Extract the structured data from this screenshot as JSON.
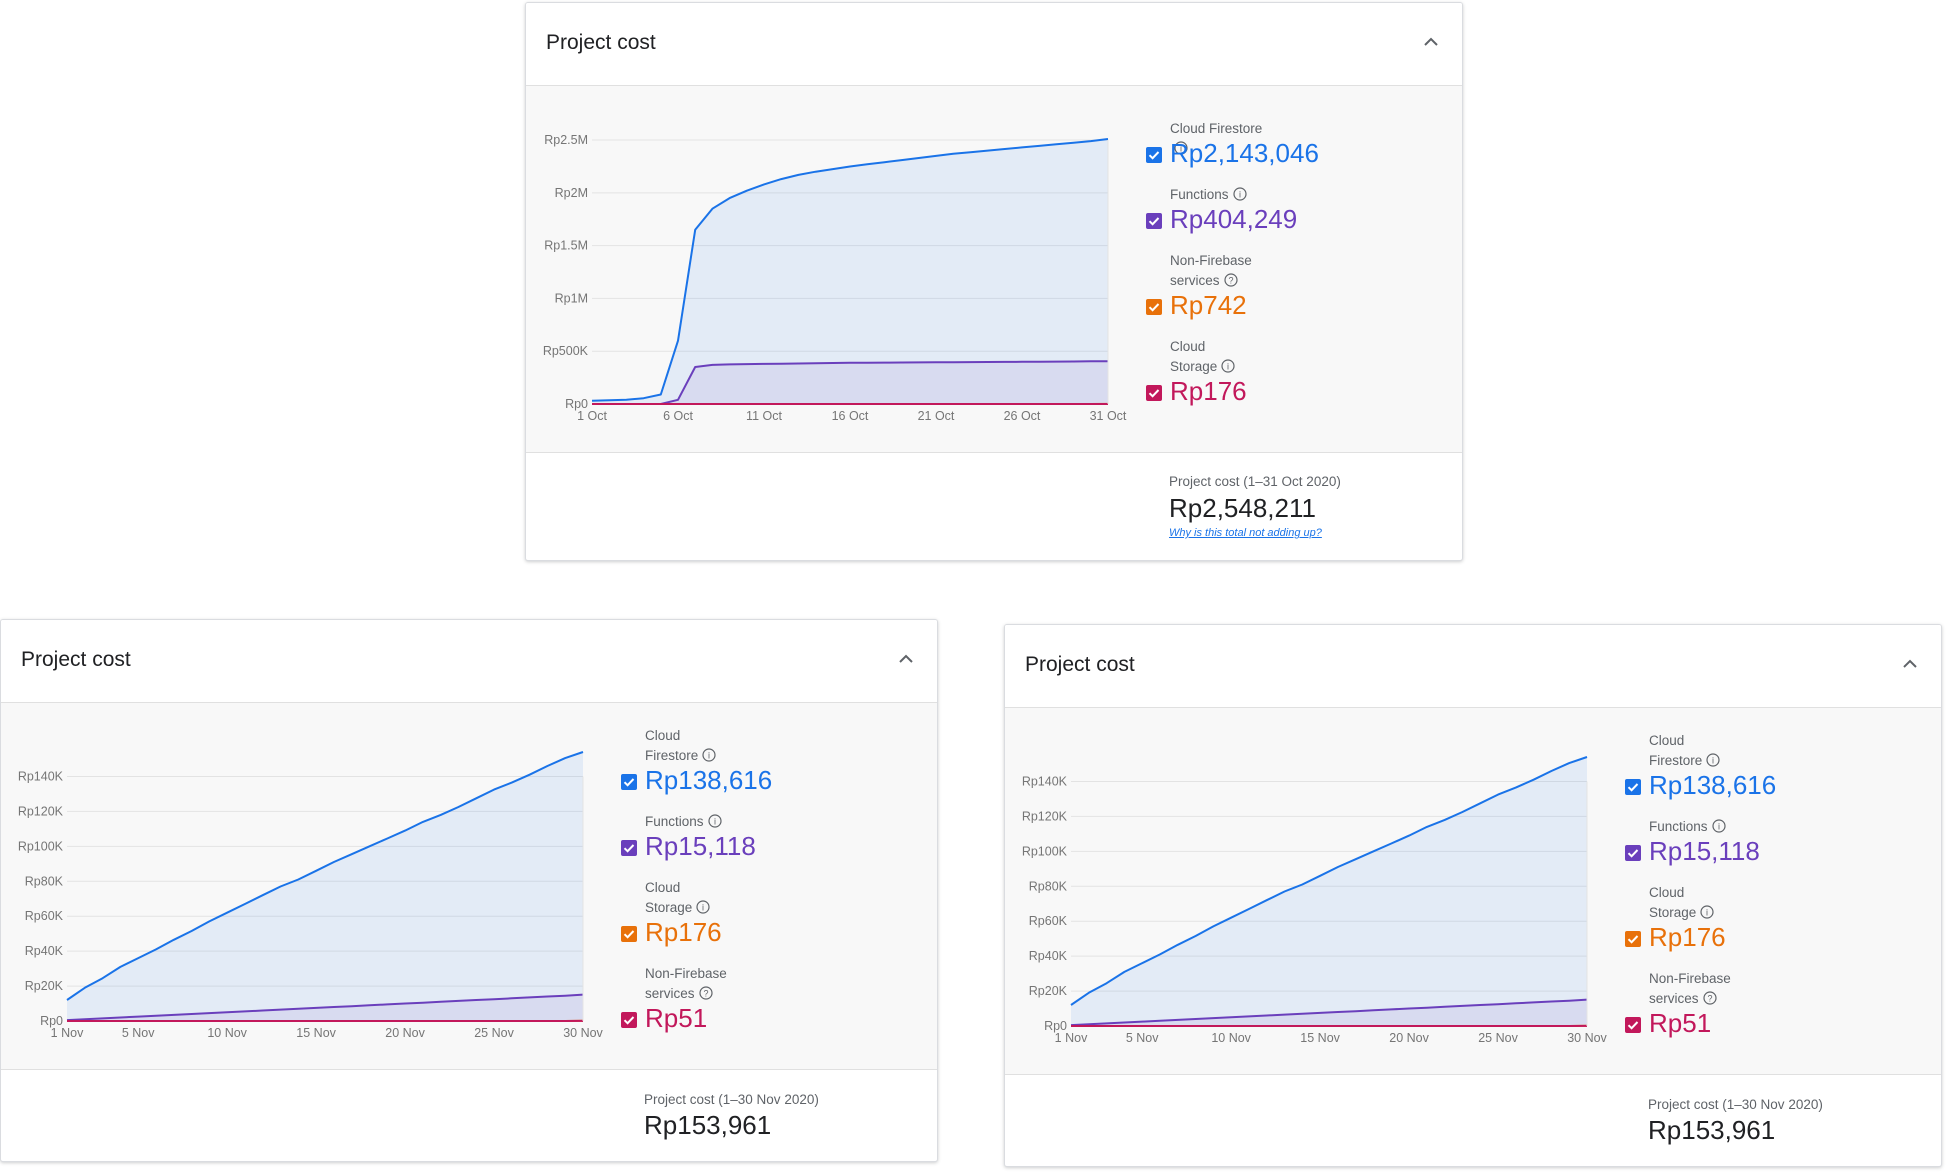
{
  "cards": [
    {
      "title": "Project cost",
      "legend": [
        {
          "name_lines": [
            "Cloud Firestore"
          ],
          "info": "i",
          "value": "Rp2,143,046",
          "color": "#1a73e8"
        },
        {
          "name_lines": [
            "Functions"
          ],
          "info": "i",
          "value": "Rp404,249",
          "color": "#6a3fbc"
        },
        {
          "name_lines": [
            "Non-Firebase",
            "services"
          ],
          "info": "?",
          "value": "Rp742",
          "color": "#e8710a"
        },
        {
          "name_lines": [
            "Cloud",
            "Storage"
          ],
          "info": "i",
          "value": "Rp176",
          "color": "#c2185b"
        }
      ],
      "total": {
        "label": "Project cost (1–31 Oct 2020)",
        "value": "Rp2,548,211",
        "link": "Why is this total not adding up?"
      }
    },
    {
      "title": "Project cost",
      "legend": [
        {
          "name_lines": [
            "Cloud",
            "Firestore"
          ],
          "info": "i",
          "value": "Rp138,616",
          "color": "#1a73e8"
        },
        {
          "name_lines": [
            "Functions"
          ],
          "info": "i",
          "value": "Rp15,118",
          "color": "#6a3fbc"
        },
        {
          "name_lines": [
            "Cloud",
            "Storage"
          ],
          "info": "i",
          "value": "Rp176",
          "color": "#e8710a"
        },
        {
          "name_lines": [
            "Non-Firebase",
            "services"
          ],
          "info": "?",
          "value": "Rp51",
          "color": "#c2185b"
        }
      ],
      "total": {
        "label": "Project cost (1–30 Nov 2020)",
        "value": "Rp153,961",
        "link": ""
      }
    },
    {
      "title": "Project cost",
      "legend": [
        {
          "name_lines": [
            "Cloud",
            "Firestore"
          ],
          "info": "i",
          "value": "Rp138,616",
          "color": "#1a73e8"
        },
        {
          "name_lines": [
            "Functions"
          ],
          "info": "i",
          "value": "Rp15,118",
          "color": "#6a3fbc"
        },
        {
          "name_lines": [
            "Cloud",
            "Storage"
          ],
          "info": "i",
          "value": "Rp176",
          "color": "#e8710a"
        },
        {
          "name_lines": [
            "Non-Firebase",
            "services"
          ],
          "info": "?",
          "value": "Rp51",
          "color": "#c2185b"
        }
      ],
      "total": {
        "label": "Project cost (1–30 Nov 2020)",
        "value": "Rp153,961",
        "link": ""
      }
    }
  ],
  "chart_data": [
    {
      "type": "area",
      "title": "Project cost",
      "x": [
        "1 Oct",
        "2 Oct",
        "3 Oct",
        "4 Oct",
        "5 Oct",
        "6 Oct",
        "7 Oct",
        "8 Oct",
        "9 Oct",
        "10 Oct",
        "11 Oct",
        "12 Oct",
        "13 Oct",
        "14 Oct",
        "15 Oct",
        "16 Oct",
        "17 Oct",
        "18 Oct",
        "19 Oct",
        "20 Oct",
        "21 Oct",
        "22 Oct",
        "23 Oct",
        "24 Oct",
        "25 Oct",
        "26 Oct",
        "27 Oct",
        "28 Oct",
        "29 Oct",
        "30 Oct",
        "31 Oct"
      ],
      "x_ticks": [
        "1 Oct",
        "6 Oct",
        "11 Oct",
        "16 Oct",
        "21 Oct",
        "26 Oct",
        "31 Oct"
      ],
      "y_ticks": [
        "Rp0",
        "Rp500K",
        "Rp1M",
        "Rp1.5M",
        "Rp2M",
        "Rp2.5M"
      ],
      "ylim": [
        0,
        2500000
      ],
      "grid": true,
      "legend_position": "right",
      "series": [
        {
          "name": "Cloud Firestore",
          "color": "#1a73e8",
          "values": [
            30000,
            35000,
            40000,
            55000,
            90000,
            600000,
            1650000,
            1850000,
            1950000,
            2020000,
            2080000,
            2130000,
            2170000,
            2200000,
            2225000,
            2250000,
            2270000,
            2290000,
            2310000,
            2330000,
            2350000,
            2370000,
            2385000,
            2400000,
            2415000,
            2430000,
            2445000,
            2460000,
            2475000,
            2490000,
            2510000
          ]
        },
        {
          "name": "Functions",
          "color": "#6a3fbc",
          "values": [
            0,
            0,
            0,
            0,
            0,
            40000,
            350000,
            370000,
            375000,
            378000,
            380000,
            382000,
            384000,
            386000,
            388000,
            390000,
            391000,
            392000,
            393000,
            394000,
            395000,
            396000,
            397000,
            398000,
            399000,
            400000,
            401000,
            402000,
            403000,
            404000,
            405000
          ]
        },
        {
          "name": "Non-Firebase services",
          "color": "#e8710a",
          "values": [
            0,
            0,
            0,
            0,
            0,
            0,
            0,
            0,
            0,
            0,
            0,
            0,
            0,
            0,
            0,
            0,
            0,
            0,
            0,
            0,
            0,
            0,
            0,
            0,
            0,
            0,
            0,
            0,
            0,
            0,
            742
          ]
        },
        {
          "name": "Cloud Storage",
          "color": "#c2185b",
          "values": [
            0,
            0,
            0,
            0,
            0,
            0,
            0,
            0,
            0,
            0,
            0,
            0,
            0,
            0,
            0,
            0,
            0,
            0,
            0,
            0,
            0,
            0,
            0,
            0,
            0,
            0,
            0,
            0,
            0,
            0,
            176
          ]
        }
      ]
    },
    {
      "type": "area",
      "title": "Project cost",
      "x": [
        "1 Nov",
        "2 Nov",
        "3 Nov",
        "4 Nov",
        "5 Nov",
        "6 Nov",
        "7 Nov",
        "8 Nov",
        "9 Nov",
        "10 Nov",
        "11 Nov",
        "12 Nov",
        "13 Nov",
        "14 Nov",
        "15 Nov",
        "16 Nov",
        "17 Nov",
        "18 Nov",
        "19 Nov",
        "20 Nov",
        "21 Nov",
        "22 Nov",
        "23 Nov",
        "24 Nov",
        "25 Nov",
        "26 Nov",
        "27 Nov",
        "28 Nov",
        "29 Nov",
        "30 Nov"
      ],
      "x_ticks": [
        "1 Nov",
        "5 Nov",
        "10 Nov",
        "15 Nov",
        "20 Nov",
        "25 Nov",
        "30 Nov"
      ],
      "y_ticks": [
        "Rp0",
        "Rp20K",
        "Rp40K",
        "Rp60K",
        "Rp80K",
        "Rp100K",
        "Rp120K",
        "Rp140K"
      ],
      "ylim": [
        0,
        140000
      ],
      "grid": true,
      "legend_position": "right",
      "series": [
        {
          "name": "Cloud Firestore",
          "color": "#1a73e8",
          "values": [
            12000,
            19000,
            24500,
            31000,
            36000,
            41000,
            46500,
            51500,
            57000,
            62000,
            67000,
            72000,
            77000,
            81000,
            86000,
            91000,
            95500,
            100000,
            104500,
            109000,
            114000,
            118000,
            122500,
            127500,
            132500,
            136500,
            141000,
            146000,
            150500,
            154000
          ]
        },
        {
          "name": "Functions",
          "color": "#6a3fbc",
          "values": [
            500,
            1000,
            1500,
            2000,
            2500,
            3000,
            3500,
            4000,
            4500,
            5000,
            5500,
            6000,
            6500,
            7000,
            7500,
            8000,
            8500,
            9000,
            9500,
            10000,
            10500,
            11000,
            11500,
            12000,
            12500,
            13000,
            13500,
            14000,
            14500,
            15118
          ]
        },
        {
          "name": "Cloud Storage",
          "color": "#e8710a",
          "values": [
            0,
            0,
            0,
            0,
            0,
            0,
            0,
            0,
            0,
            0,
            0,
            0,
            0,
            0,
            0,
            0,
            0,
            0,
            0,
            0,
            0,
            0,
            0,
            0,
            0,
            0,
            0,
            0,
            0,
            176
          ]
        },
        {
          "name": "Non-Firebase services",
          "color": "#c2185b",
          "values": [
            0,
            0,
            0,
            0,
            0,
            0,
            0,
            0,
            0,
            0,
            0,
            0,
            0,
            0,
            0,
            0,
            0,
            0,
            0,
            0,
            0,
            0,
            0,
            0,
            0,
            0,
            0,
            0,
            0,
            51
          ]
        }
      ]
    },
    {
      "type": "area",
      "title": "Project cost",
      "x": [
        "1 Nov",
        "2 Nov",
        "3 Nov",
        "4 Nov",
        "5 Nov",
        "6 Nov",
        "7 Nov",
        "8 Nov",
        "9 Nov",
        "10 Nov",
        "11 Nov",
        "12 Nov",
        "13 Nov",
        "14 Nov",
        "15 Nov",
        "16 Nov",
        "17 Nov",
        "18 Nov",
        "19 Nov",
        "20 Nov",
        "21 Nov",
        "22 Nov",
        "23 Nov",
        "24 Nov",
        "25 Nov",
        "26 Nov",
        "27 Nov",
        "28 Nov",
        "29 Nov",
        "30 Nov"
      ],
      "x_ticks": [
        "1 Nov",
        "5 Nov",
        "10 Nov",
        "15 Nov",
        "20 Nov",
        "25 Nov",
        "30 Nov"
      ],
      "y_ticks": [
        "Rp0",
        "Rp20K",
        "Rp40K",
        "Rp60K",
        "Rp80K",
        "Rp100K",
        "Rp120K",
        "Rp140K"
      ],
      "ylim": [
        0,
        140000
      ],
      "grid": true,
      "legend_position": "right",
      "series": [
        {
          "name": "Cloud Firestore",
          "color": "#1a73e8",
          "values": [
            12000,
            19000,
            24500,
            31000,
            36000,
            41000,
            46500,
            51500,
            57000,
            62000,
            67000,
            72000,
            77000,
            81000,
            86000,
            91000,
            95500,
            100000,
            104500,
            109000,
            114000,
            118000,
            122500,
            127500,
            132500,
            136500,
            141000,
            146000,
            150500,
            154000
          ]
        },
        {
          "name": "Functions",
          "color": "#6a3fbc",
          "values": [
            500,
            1000,
            1500,
            2000,
            2500,
            3000,
            3500,
            4000,
            4500,
            5000,
            5500,
            6000,
            6500,
            7000,
            7500,
            8000,
            8500,
            9000,
            9500,
            10000,
            10500,
            11000,
            11500,
            12000,
            12500,
            13000,
            13500,
            14000,
            14500,
            15118
          ]
        },
        {
          "name": "Cloud Storage",
          "color": "#e8710a",
          "values": [
            0,
            0,
            0,
            0,
            0,
            0,
            0,
            0,
            0,
            0,
            0,
            0,
            0,
            0,
            0,
            0,
            0,
            0,
            0,
            0,
            0,
            0,
            0,
            0,
            0,
            0,
            0,
            0,
            0,
            176
          ]
        },
        {
          "name": "Non-Firebase services",
          "color": "#c2185b",
          "values": [
            0,
            0,
            0,
            0,
            0,
            0,
            0,
            0,
            0,
            0,
            0,
            0,
            0,
            0,
            0,
            0,
            0,
            0,
            0,
            0,
            0,
            0,
            0,
            0,
            0,
            0,
            0,
            0,
            0,
            51
          ]
        }
      ]
    }
  ]
}
